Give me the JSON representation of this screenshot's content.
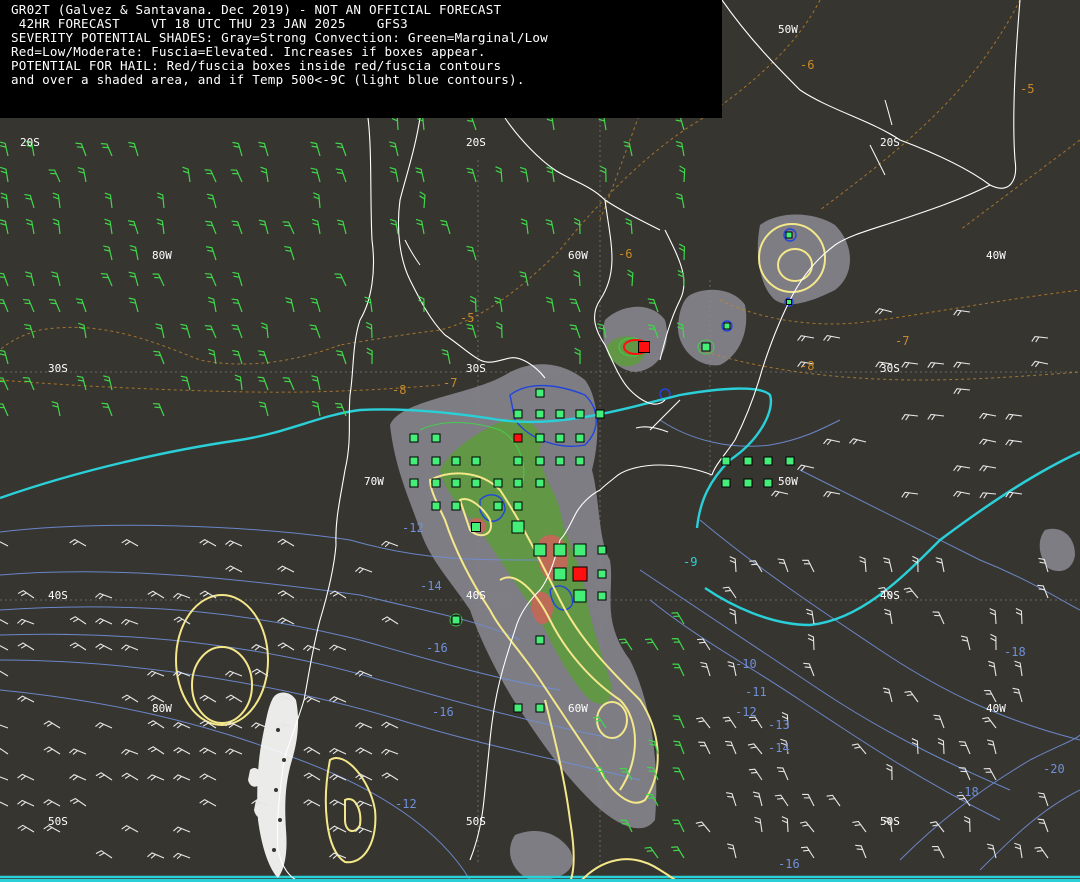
{
  "header": {
    "lines": [
      "GR02T (Galvez & Santavana. Dec 2019) - NOT AN OFFICIAL FORECAST",
      " 42HR FORECAST    VT 18 UTC THU 23 JAN 2025    GFS3",
      "SEVERITY POTENTIAL SHADES: Gray=Strong Convection: Green=Marginal/Low",
      "Red=Low/Moderate: Fuscia=Elevated. Increases if boxes appear.",
      "POTENTIAL FOR HAIL: Red/fuscia boxes inside red/fuscia contours",
      "and over a shaded area, and if Temp 500<-9C (light blue contours)."
    ]
  },
  "grid_labels": {
    "lon_50w_top": "50W",
    "lat_20s_left": "20S",
    "lat_20s_right": "20S",
    "lon_80w_a": "80W",
    "lon_60w_a": "60W",
    "lon_40w_a": "40W",
    "lat_30s_left": "30S",
    "lat_30s_mid": "30S",
    "lat_30s_right": "30S",
    "lon_70w_b": "70W",
    "lon_50w_b": "50W",
    "lat_40s_left": "40S",
    "lat_40s_mid": "40S",
    "lat_40s_right": "40S",
    "lon_80w_c": "80W",
    "lon_60w_c": "60W",
    "lon_40w_c": "40W",
    "lat_50s_left": "50S",
    "lat_50s_mid": "50S",
    "lat_50s_right": "50S"
  },
  "contour_labels": {
    "t_m6_top": "-6",
    "t_m5_right": "-5",
    "t_m6_mid": "-6",
    "t_m5_mid": "-5",
    "t_m7_right": "-7",
    "t_m8_right": "-8",
    "t_m7_mid": "-7",
    "t_m8_left": "-8",
    "t_m9_cyan": "-9",
    "t_m12_left": "-12",
    "t_m14_left": "-14",
    "t_m16_left": "-16",
    "t_m16_b": "-16",
    "t_m10": "-10",
    "t_m11": "-11",
    "t_m12": "-12",
    "t_m13": "-13",
    "t_m14": "-14",
    "t_m18_a": "-18",
    "t_m18_b": "-18",
    "t_m20": "-20",
    "t_m16_c": "-16",
    "t_m12_d": "-12"
  },
  "colors": {
    "background": "#373530",
    "coastline": "#ffffff",
    "gray_shade": "#8a8a92",
    "green_shade": "#5e9a3e",
    "red_shade": "#c8665a",
    "box_green": "#44ee77",
    "box_red": "#ff1010",
    "yellow_contour": "#f4e88a",
    "blue_contour": "#6f8fd8",
    "dark_blue_contour": "#2244dd",
    "cyan_contour": "#2ad0d8",
    "temp_label_orange": "#c88a2a",
    "wind_barb_green": "#3fd84a",
    "wind_barb_white": "#e6e6e6"
  }
}
